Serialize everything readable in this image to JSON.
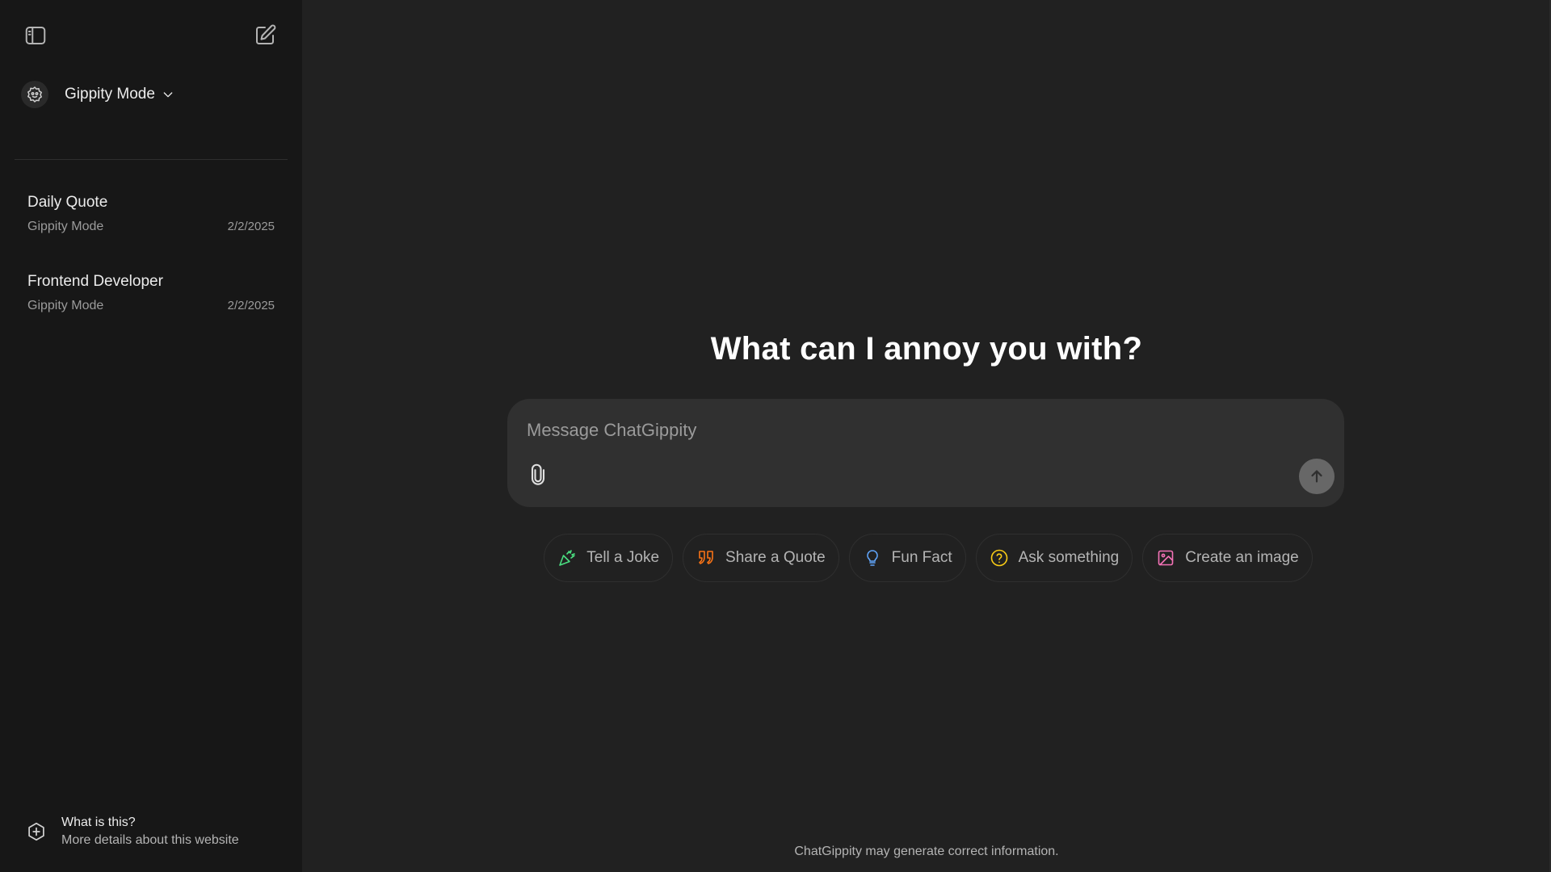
{
  "sidebar": {
    "mode": {
      "label": "Gippity Mode",
      "icon": "robot-icon"
    },
    "chats": [
      {
        "title": "Daily Quote",
        "mode": "Gippity Mode",
        "date": "2/2/2025"
      },
      {
        "title": "Frontend Developer",
        "mode": "Gippity Mode",
        "date": "2/2/2025"
      }
    ],
    "about": {
      "title": "What is this?",
      "subtitle": "More details about this website"
    }
  },
  "main": {
    "headline": "What can I annoy you with?",
    "composer": {
      "placeholder": "Message ChatGippity"
    },
    "chips": [
      {
        "label": "Tell a Joke",
        "icon": "party-popper-icon",
        "color": "#4ade80"
      },
      {
        "label": "Share a Quote",
        "icon": "quote-icon",
        "color": "#f97316"
      },
      {
        "label": "Fun Fact",
        "icon": "lightbulb-icon",
        "color": "#60a5fa"
      },
      {
        "label": "Ask something",
        "icon": "question-circle-icon",
        "color": "#facc15"
      },
      {
        "label": "Create an image",
        "icon": "image-icon",
        "color": "#f472b6"
      }
    ],
    "footer": "ChatGippity may generate correct information."
  }
}
